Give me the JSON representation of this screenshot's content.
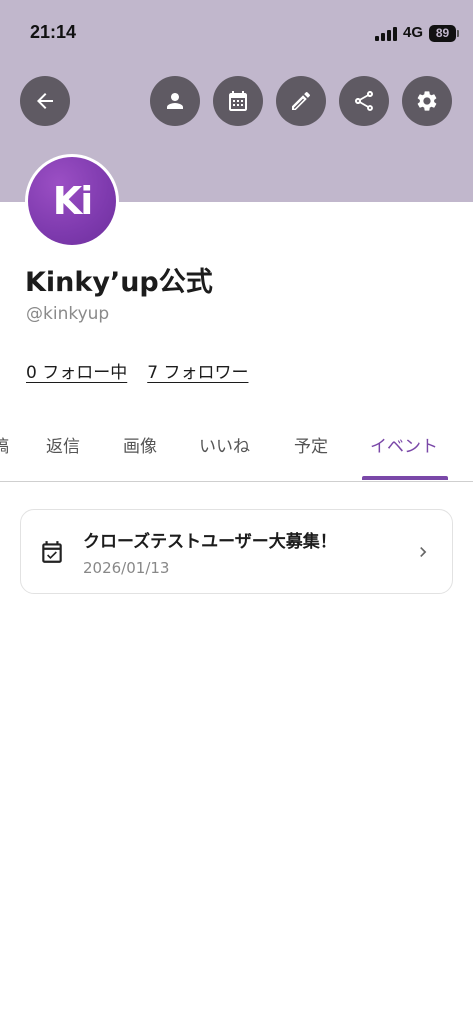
{
  "status_bar": {
    "time": "21:14",
    "network": "4G",
    "battery": "89"
  },
  "header": {
    "buttons": [
      {
        "name": "back-button",
        "icon": "arrow-back-icon"
      },
      {
        "name": "profile-button",
        "icon": "person-icon"
      },
      {
        "name": "calendar-button",
        "icon": "calendar-icon"
      },
      {
        "name": "edit-button",
        "icon": "pencil-icon"
      },
      {
        "name": "share-button",
        "icon": "share-icon"
      },
      {
        "name": "settings-button",
        "icon": "gear-icon"
      }
    ],
    "background_color": "#c1b7cc",
    "button_color": "#5f5a63"
  },
  "profile": {
    "avatar_text": "Ki",
    "display_name": "Kinky’up公式",
    "handle": "@kinkyup",
    "following": "0 フォロー中",
    "followers": "7 フォロワー"
  },
  "tabs": {
    "items": [
      "稿",
      "返信",
      "画像",
      "いいね",
      "予定",
      "イベント"
    ],
    "active": "イベント",
    "accent_color": "#7a48a8"
  },
  "events": [
    {
      "title": "クローズテストユーザー大募集！",
      "date": "2026/01/13",
      "icon": "calendar-check-icon"
    }
  ]
}
